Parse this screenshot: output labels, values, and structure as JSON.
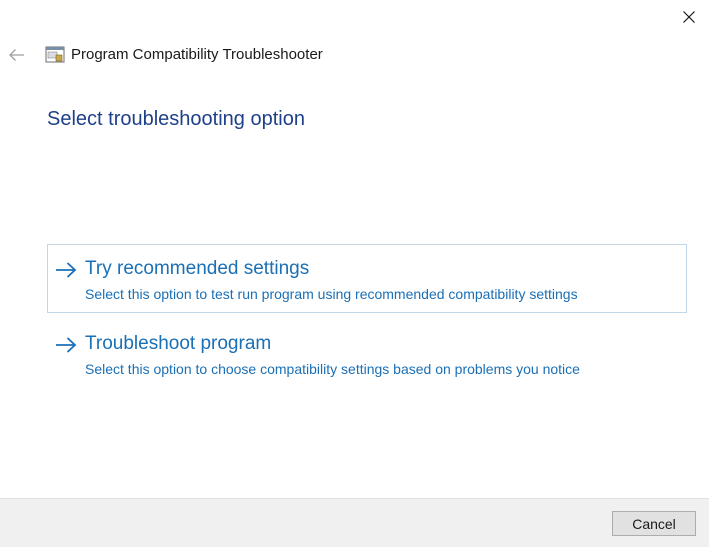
{
  "window": {
    "title": "Program Compatibility Troubleshooter",
    "icon": "troubleshooter-app-icon",
    "close_icon": "close-icon",
    "back_icon": "back-arrow-icon"
  },
  "page": {
    "heading": "Select troubleshooting option"
  },
  "options": [
    {
      "title": "Try recommended settings",
      "description": "Select this option to test run program using recommended compatibility settings",
      "selected": true
    },
    {
      "title": "Troubleshoot program",
      "description": "Select this option to choose compatibility settings based on problems you notice",
      "selected": false
    }
  ],
  "footer": {
    "cancel_label": "Cancel"
  },
  "colors": {
    "heading": "#1e3f8a",
    "link": "#1a6fb5",
    "selected_border": "#c2d6ea",
    "footer_bg": "#f0f0f0"
  }
}
